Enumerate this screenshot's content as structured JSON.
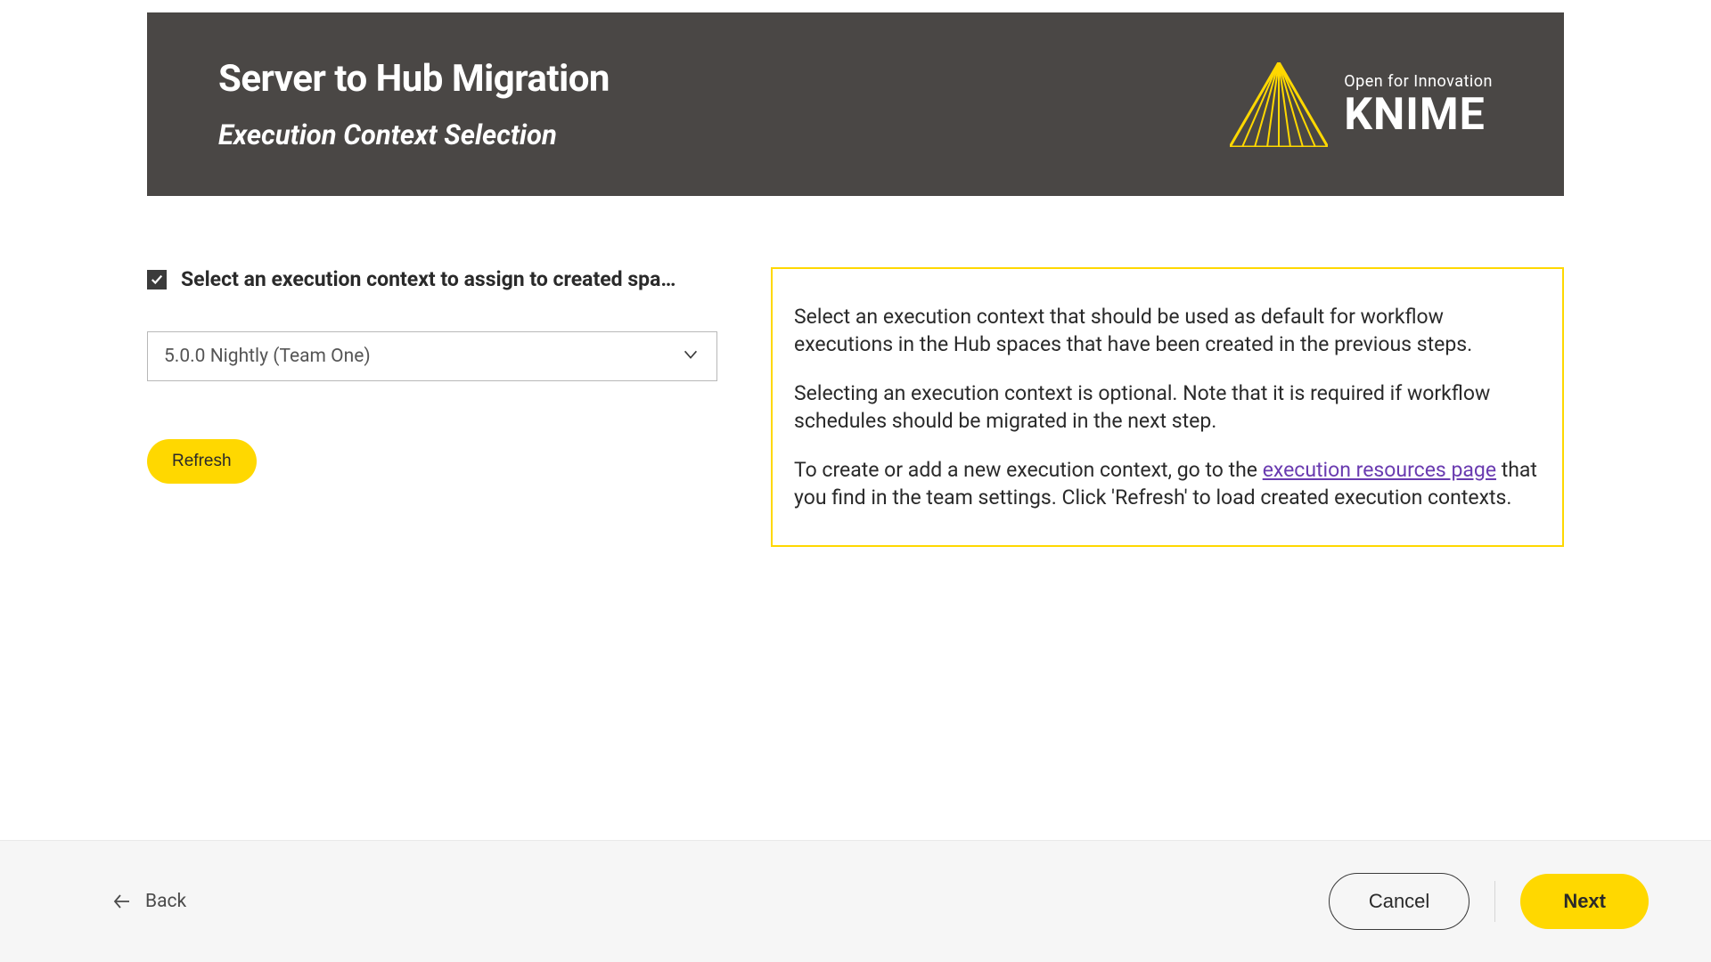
{
  "header": {
    "title": "Server to Hub Migration",
    "subtitle": "Execution Context Selection",
    "logo_tagline": "Open for Innovation",
    "logo_name": "KNIME"
  },
  "form": {
    "checkbox_label": "Select an execution context to assign to created spa…",
    "checkbox_checked": true,
    "select_value": "5.0.0 Nightly (Team One)",
    "refresh_label": "Refresh"
  },
  "info": {
    "p1": "Select an execution context that should be used as default for workflow executions in the Hub spaces that have been created in the previous steps.",
    "p2": "Selecting an execution context is optional. Note that it is required if workflow schedules should be migrated in the next step.",
    "p3_prefix": "To create or add a new execution context, go to the ",
    "p3_link": "execution resources page",
    "p3_suffix": " that you find in the team settings. Click 'Refresh' to load created execution contexts."
  },
  "footer": {
    "back_label": "Back",
    "cancel_label": "Cancel",
    "next_label": "Next"
  }
}
